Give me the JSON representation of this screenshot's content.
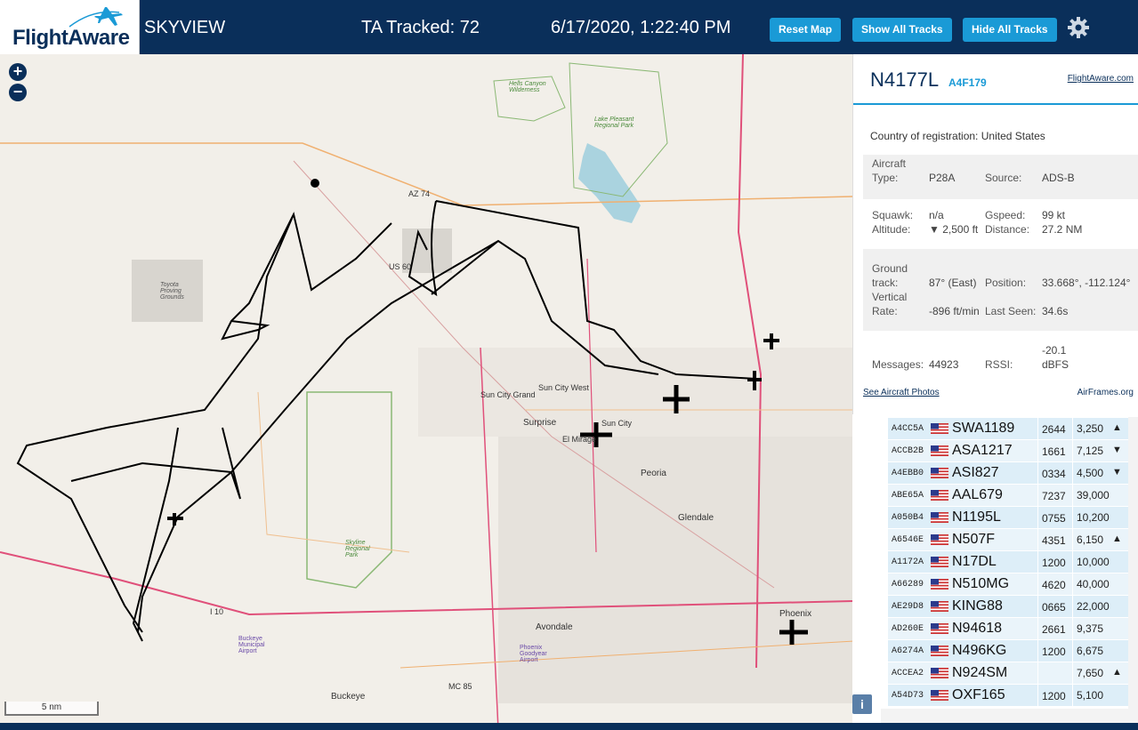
{
  "header": {
    "logo_text": "FlightAware",
    "app_title": "SKYVIEW",
    "tracked": "TA Tracked: 72",
    "datetime": "6/17/2020, 1:22:40 PM",
    "buttons": {
      "reset": "Reset Map",
      "show": "Show All Tracks",
      "hide": "Hide All Tracks"
    },
    "settings_icon": "gear-icon"
  },
  "map": {
    "zoom_in": "+",
    "zoom_out": "−",
    "scale": "5 nm",
    "info": "i",
    "places": [
      {
        "name": "Hells Canyon Wilderness"
      },
      {
        "name": "Lake Pleasant Regional Park"
      },
      {
        "name": "Toyota Proving Grounds"
      },
      {
        "name": "Sun City Grand"
      },
      {
        "name": "Sun City West"
      },
      {
        "name": "Surprise"
      },
      {
        "name": "Sun City"
      },
      {
        "name": "El Mirage"
      },
      {
        "name": "Peoria"
      },
      {
        "name": "Glendale"
      },
      {
        "name": "Skyline Regional Park"
      },
      {
        "name": "Avondale"
      },
      {
        "name": "Phoenix"
      },
      {
        "name": "Buckeye"
      },
      {
        "name": "Buckeye Municipal Airport"
      },
      {
        "name": "Phoenix Goodyear Airport"
      }
    ],
    "road_labels": [
      "AZ 74",
      "US 60",
      "I 10",
      "MC 85"
    ]
  },
  "aircraft": {
    "registration": "N4177L",
    "hex": "A4F179",
    "link": "FlightAware.com",
    "country_label": "Country of registration:",
    "country": "United States",
    "type_label": "Aircraft Type:",
    "type": "P28A",
    "source_label": "Source:",
    "source": "ADS-B",
    "squawk_label": "Squawk:",
    "squawk": "n/a",
    "gspeed_label": "Gspeed:",
    "gspeed": "99 kt",
    "altitude_label": "Altitude:",
    "altitude": "▼ 2,500 ft",
    "distance_label": "Distance:",
    "distance": "27.2 NM",
    "track_label": "Ground track:",
    "track": "87° (East)",
    "position_label": "Position:",
    "position": "33.668°, -112.124°",
    "vrate_label": "Vertical Rate:",
    "vrate": "-896 ft/min",
    "lastseen_label": "Last Seen:",
    "lastseen": "34.6s",
    "messages_label": "Messages:",
    "messages": "44923",
    "rssi_label": "RSSI:",
    "rssi": "-20.1 dBFS",
    "photos_link": "See Aircraft Photos",
    "airframes_link": "AirFrames.org"
  },
  "table": {
    "rows": [
      {
        "hex": "A4CC5A",
        "call": "SWA1189",
        "squawk": "2644",
        "alt": "3,250",
        "trend": "▲"
      },
      {
        "hex": "ACCB2B",
        "call": "ASA1217",
        "squawk": "1661",
        "alt": "7,125",
        "trend": "▼"
      },
      {
        "hex": "A4EBB0",
        "call": "ASI827",
        "squawk": "0334",
        "alt": "4,500",
        "trend": "▼"
      },
      {
        "hex": "ABE65A",
        "call": "AAL679",
        "squawk": "7237",
        "alt": "39,000",
        "trend": ""
      },
      {
        "hex": "A050B4",
        "call": "N1195L",
        "squawk": "0755",
        "alt": "10,200",
        "trend": ""
      },
      {
        "hex": "A6546E",
        "call": "N507F",
        "squawk": "4351",
        "alt": "6,150",
        "trend": "▲"
      },
      {
        "hex": "A1172A",
        "call": "N17DL",
        "squawk": "1200",
        "alt": "10,000",
        "trend": ""
      },
      {
        "hex": "A66289",
        "call": "N510MG",
        "squawk": "4620",
        "alt": "40,000",
        "trend": ""
      },
      {
        "hex": "AE29D8",
        "call": "KING88",
        "squawk": "0665",
        "alt": "22,000",
        "trend": ""
      },
      {
        "hex": "AD260E",
        "call": "N94618",
        "squawk": "2661",
        "alt": "9,375",
        "trend": ""
      },
      {
        "hex": "A6274A",
        "call": "N496KG",
        "squawk": "1200",
        "alt": "6,675",
        "trend": ""
      },
      {
        "hex": "ACCEA2",
        "call": "N924SM",
        "squawk": "",
        "alt": "7,650",
        "trend": "▲"
      },
      {
        "hex": "A54D73",
        "call": "OXF165",
        "squawk": "1200",
        "alt": "5,100",
        "trend": ""
      }
    ]
  },
  "colors": {
    "header_bg": "#0a2f5a",
    "accent": "#1a9ad6",
    "map_bg": "#f2efe9",
    "track": "#000000",
    "highway": "#e0507a"
  }
}
